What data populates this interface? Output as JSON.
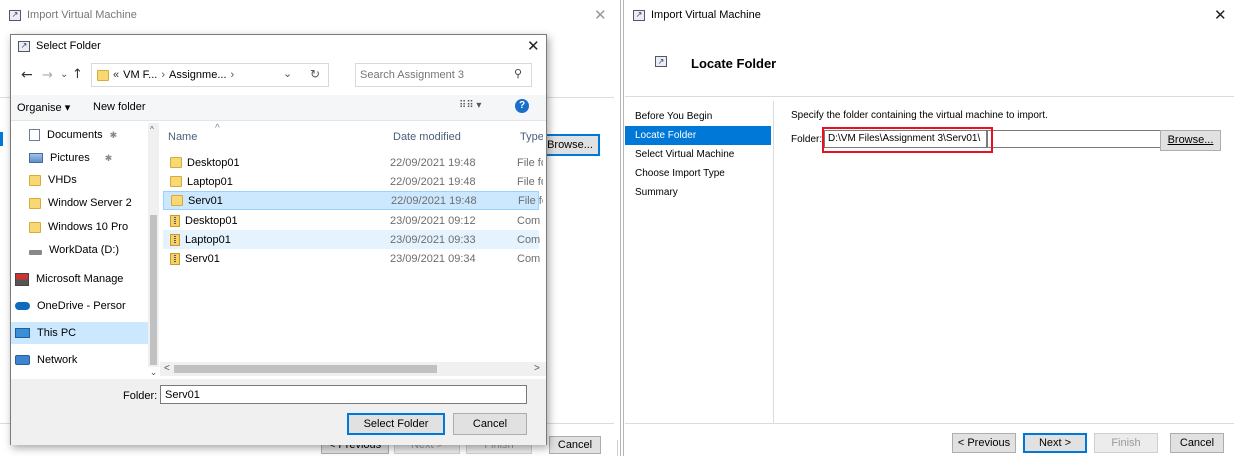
{
  "bg_wizard": {
    "title": "Import Virtual Machine",
    "browse_label": "Browse...",
    "previous_label": "< Previous",
    "next_label": "Next >",
    "finish_label": "Finish",
    "cancel_label": "Cancel"
  },
  "select_folder": {
    "title": "Select Folder",
    "breadcrumb": {
      "prefix": "«",
      "segments": [
        "VM F...",
        "Assignme..."
      ]
    },
    "search_placeholder": "Search Assignment 3",
    "toolbar": {
      "organise_label": "Organise ▾",
      "new_folder_label": "New folder"
    },
    "tree": [
      {
        "label": "Documents",
        "icon": "documents-icon",
        "pinned": true
      },
      {
        "label": "Pictures",
        "icon": "pictures-icon",
        "pinned": true
      },
      {
        "label": "VHDs",
        "icon": "folder-icon"
      },
      {
        "label": "Window Server 2",
        "icon": "folder-icon"
      },
      {
        "label": "Windows 10 Pro",
        "icon": "folder-icon"
      },
      {
        "label": "WorkData (D:)",
        "icon": "drive-icon"
      },
      {
        "label": "Microsoft Manage",
        "icon": "mmc-icon"
      },
      {
        "label": "OneDrive - Persor",
        "icon": "onedrive-icon"
      },
      {
        "label": "This PC",
        "icon": "this-pc-icon",
        "selected": true
      },
      {
        "label": "Network",
        "icon": "network-icon"
      }
    ],
    "columns": {
      "name": "Name",
      "date": "Date modified",
      "type": "Type"
    },
    "files": [
      {
        "name": "Desktop01",
        "date": "22/09/2021 19:48",
        "type": "File fo",
        "icon": "folder-icon"
      },
      {
        "name": "Laptop01",
        "date": "22/09/2021 19:48",
        "type": "File fo",
        "icon": "folder-icon"
      },
      {
        "name": "Serv01",
        "date": "22/09/2021 19:48",
        "type": "File fo",
        "icon": "folder-icon",
        "selected": true
      },
      {
        "name": "Desktop01",
        "date": "23/09/2021 09:12",
        "type": "Com",
        "icon": "zip-icon"
      },
      {
        "name": "Laptop01",
        "date": "23/09/2021 09:33",
        "type": "Com",
        "icon": "zip-icon",
        "hover": true
      },
      {
        "name": "Serv01",
        "date": "23/09/2021 09:34",
        "type": "Com",
        "icon": "zip-icon"
      }
    ],
    "folder_label": "Folder:",
    "folder_value": "Serv01",
    "select_button": "Select Folder",
    "cancel_button": "Cancel"
  },
  "wizard": {
    "title": "Import Virtual Machine",
    "header": "Locate Folder",
    "steps": [
      "Before You Begin",
      "Locate Folder",
      "Select Virtual Machine",
      "Choose Import Type",
      "Summary"
    ],
    "active_step": 1,
    "instruction": "Specify the folder containing the virtual machine to import.",
    "folder_label": "Folder:",
    "folder_value": "D:\\VM Files\\Assignment 3\\Serv01\\",
    "browse_label": "Browse...",
    "previous_label": "< Previous",
    "next_label": "Next >",
    "finish_label": "Finish",
    "cancel_label": "Cancel",
    "colors": {
      "active_step_bg": "#0078d7",
      "highlight_box": "#e81123"
    }
  }
}
